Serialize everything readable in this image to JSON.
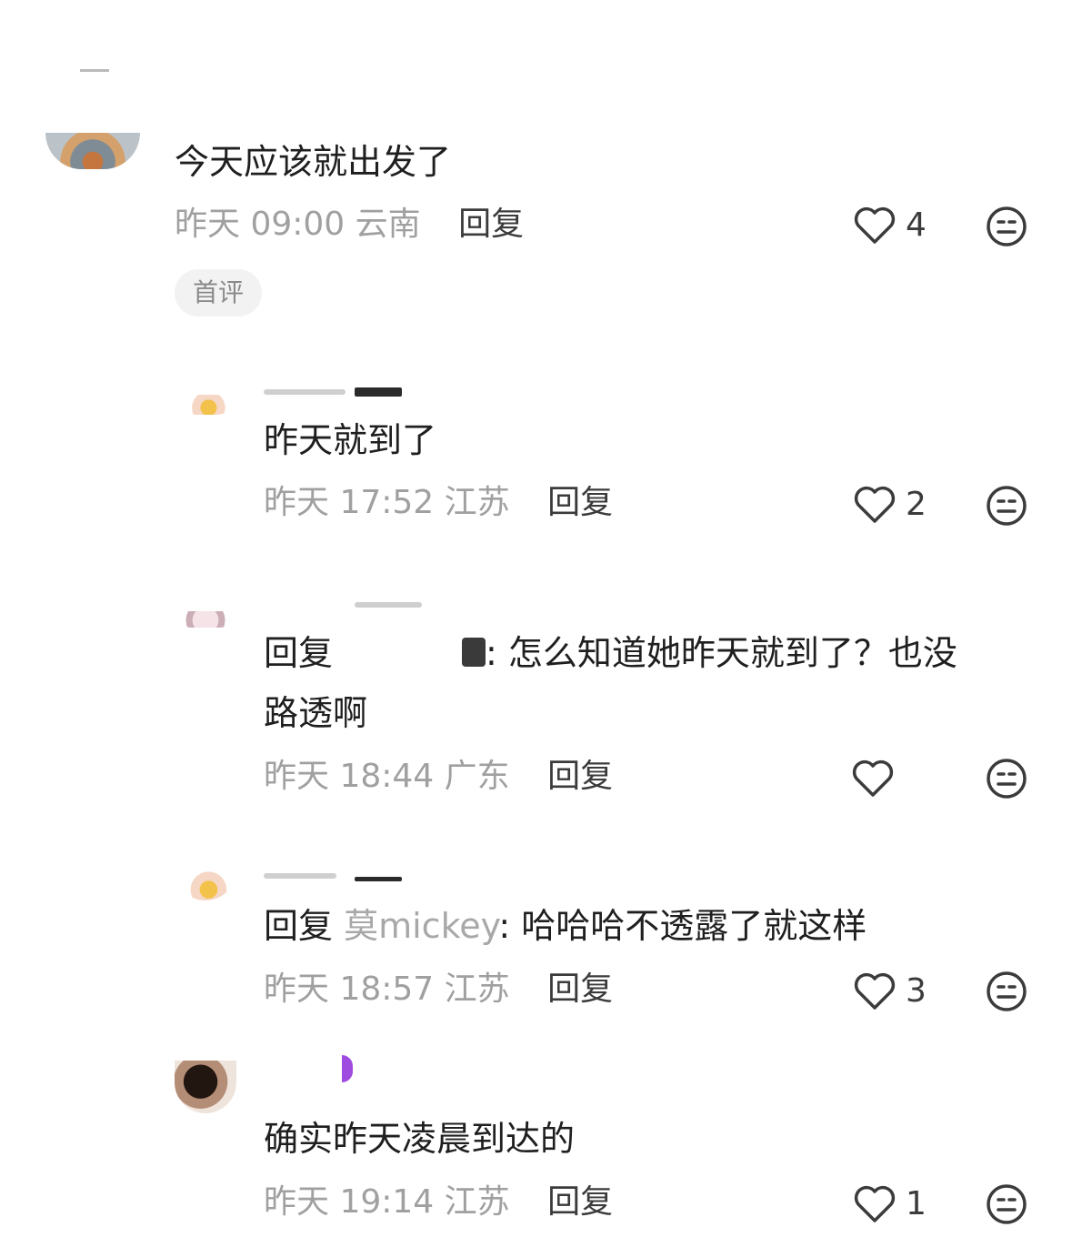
{
  "comments": [
    {
      "text": "今天应该就出发了",
      "time": "昨天 09:00",
      "location": "云南",
      "reply_label": "回复",
      "likes": "4",
      "badge": "首评"
    },
    {
      "text": "昨天就到了",
      "time": "昨天 17:52",
      "location": "江苏",
      "reply_label": "回复",
      "likes": "2"
    },
    {
      "reply_prefix": "回复",
      "text_line1": ": 怎么知道她昨天就到了？也没",
      "text_line2": "路透啊",
      "time": "昨天 18:44",
      "location": "广东",
      "reply_label": "回复",
      "likes": ""
    },
    {
      "reply_prefix": "回复",
      "mention": "莫mickey",
      "text": ": 哈哈哈不透露了就这样",
      "time": "昨天 18:57",
      "location": "江苏",
      "reply_label": "回复",
      "likes": "3"
    },
    {
      "text": "确实昨天凌晨到达的",
      "time": "昨天 19:14",
      "location": "江苏",
      "reply_label": "回复",
      "likes": "1"
    }
  ],
  "icons": {
    "like": "heart-outline-icon",
    "dislike": "meh-face-icon"
  },
  "colors": {
    "text": "#1f1f1f",
    "meta": "#a0a0a0",
    "reply": "#3b3b3b",
    "mention": "#a8a8a8"
  }
}
